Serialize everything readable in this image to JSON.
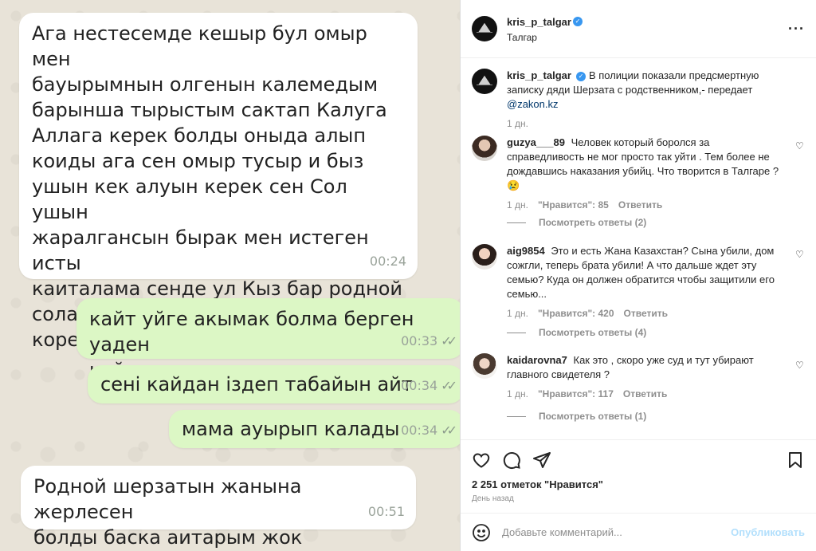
{
  "chat": {
    "messages": [
      {
        "text": "Ага нестесемде кешыр бул омыр мен\nбауырымнын олгенын калемедым\nбарынша тырыстым сактап Калуга\nАллага керек болды оныда алып\nкоиды ага сен омыр тусыр и быз\nушын кек алуын керек сен Сол ушын\nжаралгансын бырак мен истеген исты\nкаиталама сенде ул Кыз бар родной\nсоларды оила мен сени каты жаксы\nкорем кешырып кои",
        "time": "00:24",
        "emojis": [
          "smile-emoji",
          "thumbs-up-emoji"
        ]
      },
      {
        "text": "кайт уйге акымак болма берген уаден\nкайда",
        "time": "00:33"
      },
      {
        "text": "сені кайдан іздеп табайын айт",
        "time": "00:34"
      },
      {
        "text": "мама ауырып калады",
        "time": "00:34"
      },
      {
        "text": "Родной шерзатын жанына жерлесен\nболды баска аитарым жок",
        "time": "00:51"
      }
    ]
  },
  "post": {
    "username": "kris_p_talgar",
    "location": "Талгар",
    "caption": "В полиции показали предсмертную записку дяди Шерзата с родственником,- передает ",
    "caption_link": "@zakon.kz",
    "caption_time": "1 дн."
  },
  "comments": [
    {
      "username": "guzya___89",
      "text": "Человек который боролся за справедливость не мог просто так уйти . Тем более не дождавшись наказания убийц. Что творится в Талгаре ? 😢",
      "time": "1 дн.",
      "likes": "\"Нравится\": 85",
      "reply": "Ответить",
      "view_replies": "Посмотреть ответы (2)"
    },
    {
      "username": "aig9854",
      "text": "Это и есть Жана Казахстан? Сына убили, дом сожгли, теперь брата убили! А что дальше ждет эту семью? Куда он должен обратится чтобы защитили его семью...",
      "time": "1 дн.",
      "likes": "\"Нравится\": 420",
      "reply": "Ответить",
      "view_replies": "Посмотреть ответы (4)"
    },
    {
      "username": "kaidarovna7",
      "text": "Как это , скоро уже суд и тут убирают главного свидетеля ?",
      "time": "1 дн.",
      "likes": "\"Нравится\": 117",
      "reply": "Ответить",
      "view_replies": "Посмотреть ответы (1)"
    }
  ],
  "stats": {
    "likes": "2 251 отметок \"Нравится\"",
    "date": "День назад"
  },
  "composer": {
    "placeholder": "Добавьте комментарий...",
    "publish": "Опубликовать"
  },
  "icons": {
    "more": "more-options-icon",
    "like": "heart-icon",
    "comment": "comment-icon",
    "share": "share-icon",
    "save": "bookmark-icon",
    "emoji": "emoji-icon"
  }
}
